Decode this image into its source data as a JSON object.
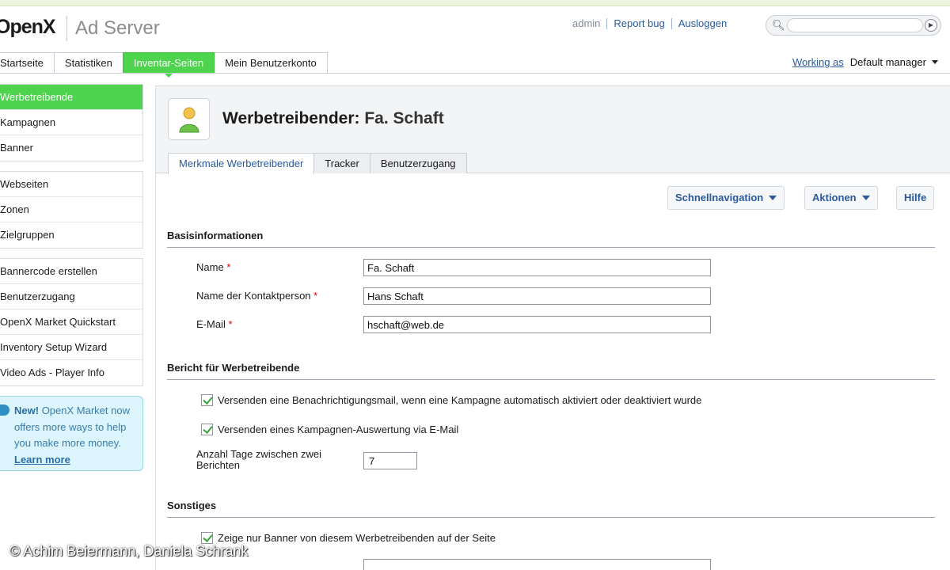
{
  "app": {
    "logo_text": "OpenX",
    "product": "Ad Server"
  },
  "toplinks": {
    "user": "admin",
    "report_bug": "Report bug",
    "logout": "Ausloggen"
  },
  "search": {
    "value": "",
    "icon": "search-icon",
    "go_icon": "play-icon"
  },
  "main_tabs": [
    "Startseite",
    "Statistiken",
    "Inventar-Seiten",
    "Mein Benutzerkonto"
  ],
  "active_main_tab": "Inventar-Seiten",
  "working_as": {
    "label": "Working as",
    "value": "Default manager"
  },
  "sidebar": {
    "group1": [
      "Werbetreibende",
      "Kampagnen",
      "Banner"
    ],
    "group2": [
      "Webseiten",
      "Zonen",
      "Zielgruppen"
    ],
    "group3": [
      "Bannercode erstellen",
      "Benutzerzugang",
      "OpenX Market Quickstart",
      "Inventory Setup Wizard",
      "Video Ads - Player Info"
    ],
    "active": "Werbetreibende"
  },
  "promo": {
    "new": "New!",
    "text": "OpenX Market now offers more ways to help you make more money.",
    "link": "Learn more"
  },
  "page": {
    "title_prefix": "Werbetreibender:",
    "title_name": "Fa. Schaft",
    "sub_tabs": [
      "Merkmale Werbetreibender",
      "Tracker",
      "Benutzerzugang"
    ],
    "active_sub_tab": "Merkmale Werbetreibender"
  },
  "actions": {
    "quicknav": "Schnellnavigation",
    "actions": "Aktionen",
    "help": "Hilfe"
  },
  "sections": {
    "basis": {
      "title": "Basisinformationen",
      "name_label": "Name",
      "name_value": "Fa. Schaft",
      "contact_label": "Name der Kontaktperson",
      "contact_value": "Hans Schaft",
      "email_label": "E-Mail",
      "email_value": "hschaft@web.de",
      "required_mark": "*"
    },
    "report": {
      "title": "Bericht für Werbetreibende",
      "cb1": "Versenden eine Benachrichtigungsmail, wenn eine Kampagne automatisch aktiviert oder deaktiviert wurde",
      "cb1_checked": true,
      "cb2": "Versenden eines Kampagnen-Auswertung via E-Mail",
      "cb2_checked": true,
      "days_label": "Anzahl Tage zwischen zwei Berichten",
      "days_value": "7"
    },
    "other": {
      "title": "Sonstiges",
      "cb3": "Zeige nur Banner von diesem Werbetreibenden auf der Seite",
      "cb3_checked": true
    }
  },
  "credit": "© Achim Beiermann, Daniela Schrank",
  "colors": {
    "accent_green": "#4ed34e",
    "link_blue": "#2a5a9a",
    "logo_orange": "#e07a1a"
  }
}
